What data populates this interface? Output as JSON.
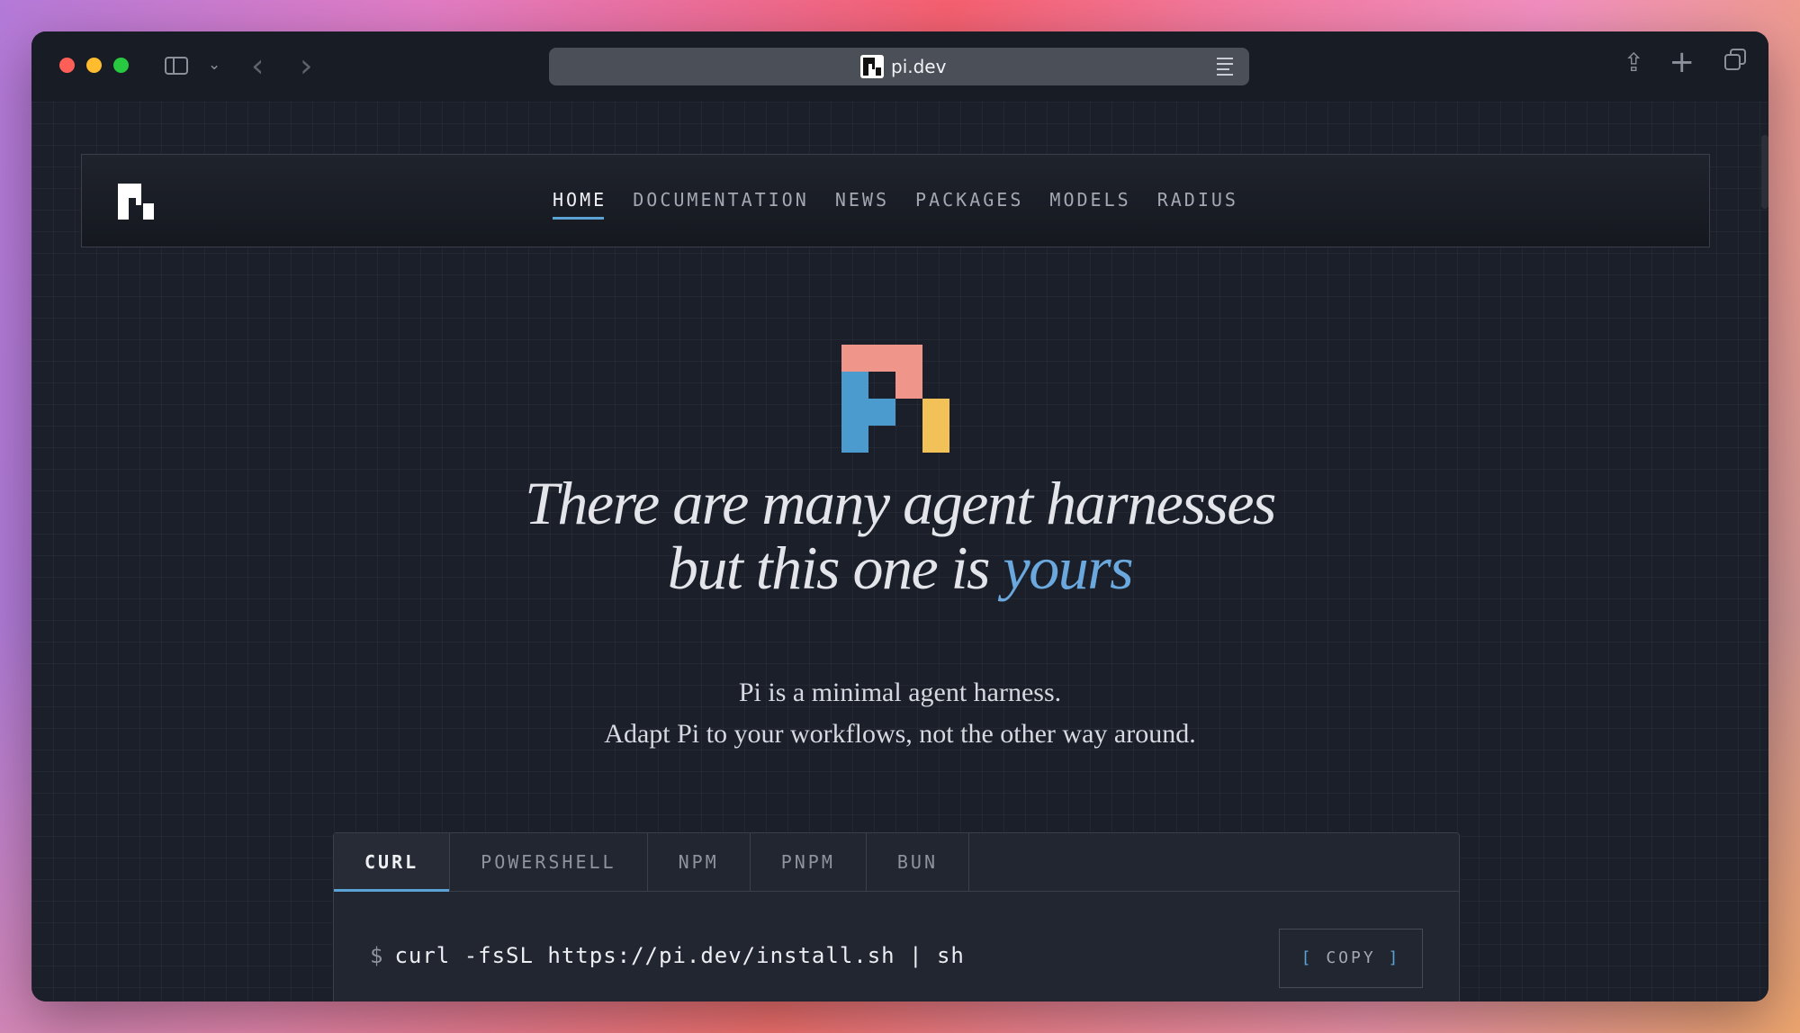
{
  "browser": {
    "url": "pi.dev"
  },
  "site": {
    "nav": [
      "HOME",
      "DOCUMENTATION",
      "NEWS",
      "PACKAGES",
      "MODELS",
      "RADIUS"
    ],
    "active_nav": "HOME"
  },
  "hero": {
    "headline_line1": "There are many agent harnesses",
    "headline_line2_prefix": "but this one is ",
    "headline_accent": "yours",
    "subtitle_line1": "Pi is a minimal agent harness.",
    "subtitle_line2": "Adapt Pi to your workflows, not the other way around."
  },
  "install": {
    "tabs": [
      "CURL",
      "POWERSHELL",
      "NPM",
      "PNPM",
      "BUN"
    ],
    "active_tab": "CURL",
    "prompt": "$",
    "command": "curl -fsSL https://pi.dev/install.sh | sh",
    "copy_open": "[",
    "copy_label": "COPY",
    "copy_close": "]"
  },
  "colors": {
    "logo_salmon": "#f0958a",
    "logo_blue": "#4b9bce",
    "logo_yellow": "#f2c157",
    "accent": "#5aa3d4"
  }
}
